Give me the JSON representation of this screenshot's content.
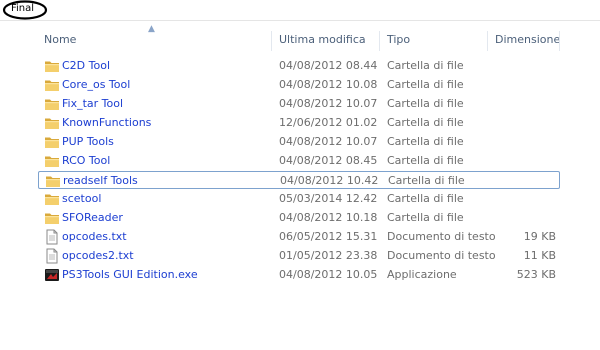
{
  "breadcrumb": {
    "label": "Final"
  },
  "columns": {
    "name": "Nome",
    "modified": "Ultima modifica",
    "type": "Tipo",
    "size": "Dimensione"
  },
  "files": [
    {
      "name": "C2D Tool",
      "modified": "04/08/2012 08.44",
      "type": "Cartella di file",
      "size": "",
      "icon": "folder-icon"
    },
    {
      "name": "Core_os Tool",
      "modified": "04/08/2012 10.08",
      "type": "Cartella di file",
      "size": "",
      "icon": "folder-icon"
    },
    {
      "name": "Fix_tar Tool",
      "modified": "04/08/2012 10.07",
      "type": "Cartella di file",
      "size": "",
      "icon": "folder-icon"
    },
    {
      "name": "KnownFunctions",
      "modified": "12/06/2012 01.02",
      "type": "Cartella di file",
      "size": "",
      "icon": "folder-icon"
    },
    {
      "name": "PUP Tools",
      "modified": "04/08/2012 10.07",
      "type": "Cartella di file",
      "size": "",
      "icon": "folder-icon"
    },
    {
      "name": "RCO Tool",
      "modified": "04/08/2012 08.45",
      "type": "Cartella di file",
      "size": "",
      "icon": "folder-icon"
    },
    {
      "name": "readself Tools",
      "modified": "04/08/2012 10.42",
      "type": "Cartella di file",
      "size": "",
      "icon": "folder-icon",
      "focused": true
    },
    {
      "name": "scetool",
      "modified": "05/03/2014 12.42",
      "type": "Cartella di file",
      "size": "",
      "icon": "folder-icon"
    },
    {
      "name": "SFOReader",
      "modified": "04/08/2012 10.18",
      "type": "Cartella di file",
      "size": "",
      "icon": "folder-icon"
    },
    {
      "name": "opcodes.txt",
      "modified": "06/05/2012 15.31",
      "type": "Documento di testo",
      "size": "19 KB",
      "icon": "text-file-icon"
    },
    {
      "name": "opcodes2.txt",
      "modified": "01/05/2012 23.38",
      "type": "Documento di testo",
      "size": "11 KB",
      "icon": "text-file-icon"
    },
    {
      "name": "PS3Tools GUI Edition.exe",
      "modified": "04/08/2012 10.05",
      "type": "Applicazione",
      "size": "523 KB",
      "icon": "exe-app-icon"
    }
  ]
}
